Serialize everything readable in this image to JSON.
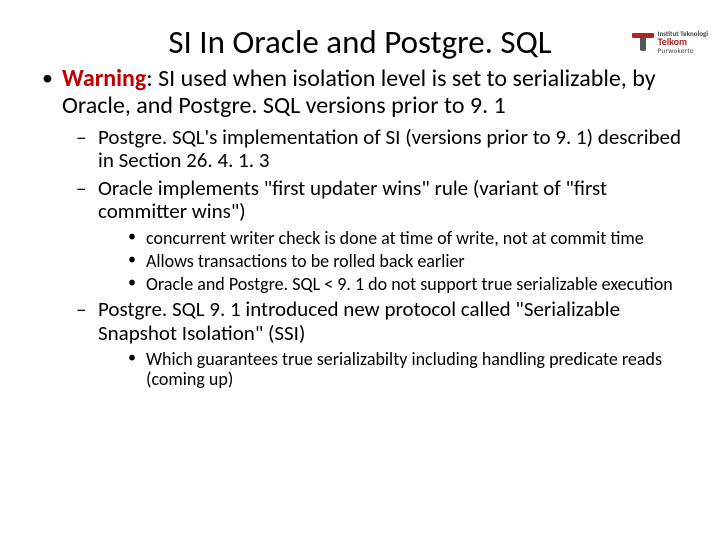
{
  "logo": {
    "line1": "Institut Teknologi",
    "line2": "Telkom",
    "line3": "Purwokerto"
  },
  "title": "SI In Oracle and Postgre. SQL",
  "bullet1": {
    "warning_label": "Warning",
    "text": ": SI used when isolation level is set to serializable, by Oracle, and Postgre. SQL versions prior to 9. 1",
    "sub": [
      "Postgre. SQL's implementation of SI (versions prior to 9. 1) described in Section 26. 4. 1. 3",
      "Oracle implements \"first updater wins\" rule (variant of \"first committer wins\")"
    ],
    "sub2_bullets": [
      "concurrent writer check is done at time of write, not at commit time",
      "Allows transactions to be rolled back earlier",
      "Oracle and Postgre. SQL < 9. 1 do not support true serializable execution"
    ],
    "sub3": "Postgre. SQL 9. 1 introduced new protocol called \"Serializable Snapshot Isolation\" (SSI)",
    "sub3_bullets": [
      "Which guarantees true serializabilty including handling predicate reads (coming up)"
    ]
  }
}
